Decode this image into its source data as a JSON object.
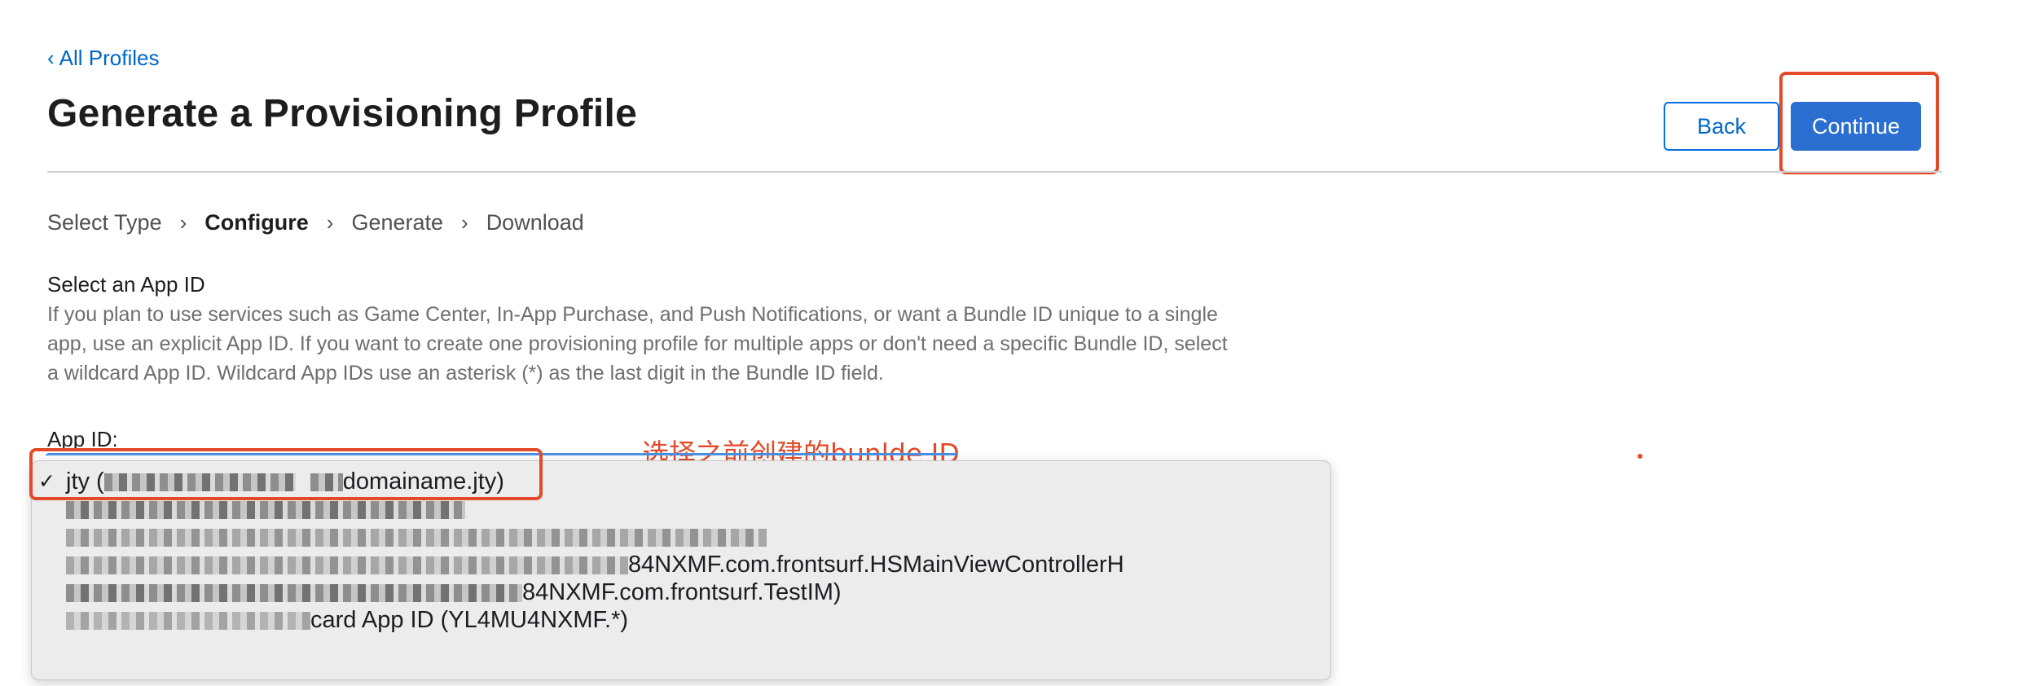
{
  "nav": {
    "back_link_chevron": "‹",
    "back_link_label": "All Profiles"
  },
  "header": {
    "title": "Generate a Provisioning Profile",
    "back_button": "Back",
    "continue_button": "Continue"
  },
  "steps": [
    {
      "label": "Select Type",
      "active": false
    },
    {
      "label": "Configure",
      "active": true
    },
    {
      "label": "Generate",
      "active": false
    },
    {
      "label": "Download",
      "active": false
    }
  ],
  "step_separator": "›",
  "section": {
    "title": "Select an App ID",
    "description": "If you plan to use services such as Game Center, In-App Purchase, and Push Notifications, or want a Bundle ID unique to a single app, use an explicit App ID. If you want to create one provisioning profile for multiple apps or don't need a specific Bundle ID, select a wildcard App ID. Wildcard App IDs use an asterisk (*) as the last digit in the Bundle ID field."
  },
  "app_id": {
    "label": "App ID:",
    "check_mark": "✓",
    "options": [
      {
        "visible_prefix": "jty (",
        "visible_suffix": "domainame.jty)",
        "selected": true
      },
      {
        "visible_prefix": "",
        "visible_suffix": "",
        "selected": false
      },
      {
        "visible_prefix": "",
        "visible_suffix": "",
        "selected": false
      },
      {
        "visible_prefix": "",
        "visible_suffix": "84NXMF.com.frontsurf.HSMainViewControllerH",
        "selected": false
      },
      {
        "visible_prefix": "",
        "visible_suffix": "84NXMF.com.frontsurf.TestIM)",
        "selected": false
      },
      {
        "visible_prefix": "",
        "visible_suffix": "card App ID (YL4MU4NXMF.*)",
        "selected": false
      }
    ]
  },
  "annotation": {
    "text": "选择之前创建的bunlde ID",
    "color": "#e34a2a"
  },
  "colors": {
    "link": "#0066cc",
    "primary_button": "#2a6ed0",
    "highlight": "#e34a2a"
  }
}
